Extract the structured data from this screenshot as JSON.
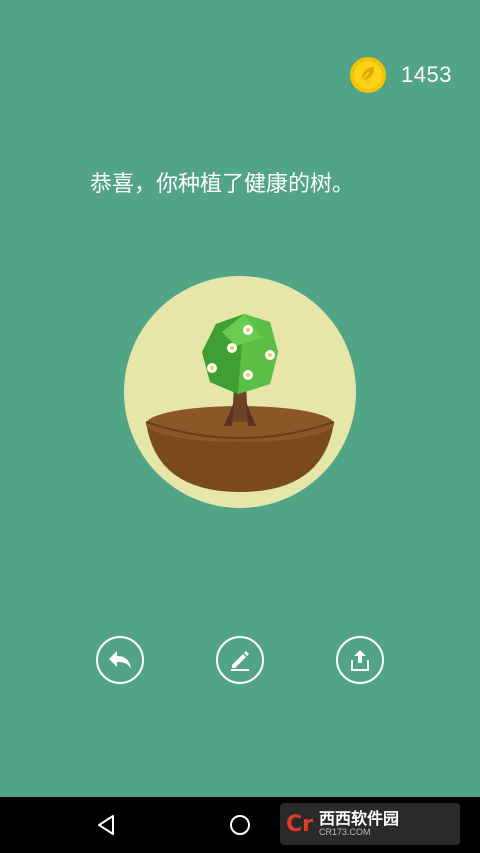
{
  "coins": {
    "count": "1453",
    "icon": "coin-icon"
  },
  "message": "恭喜，你种植了健康的树。",
  "scene": {
    "icon": "healthy-tree-illustration"
  },
  "actions": [
    {
      "icon": "undo-icon"
    },
    {
      "icon": "edit-pencil-icon"
    },
    {
      "icon": "share-icon"
    }
  ],
  "navbar": {
    "buttons": [
      "back-icon",
      "home-icon"
    ],
    "watermark": {
      "logo": "Cr",
      "name": "西西软件园",
      "url": "CR173.COM"
    }
  }
}
